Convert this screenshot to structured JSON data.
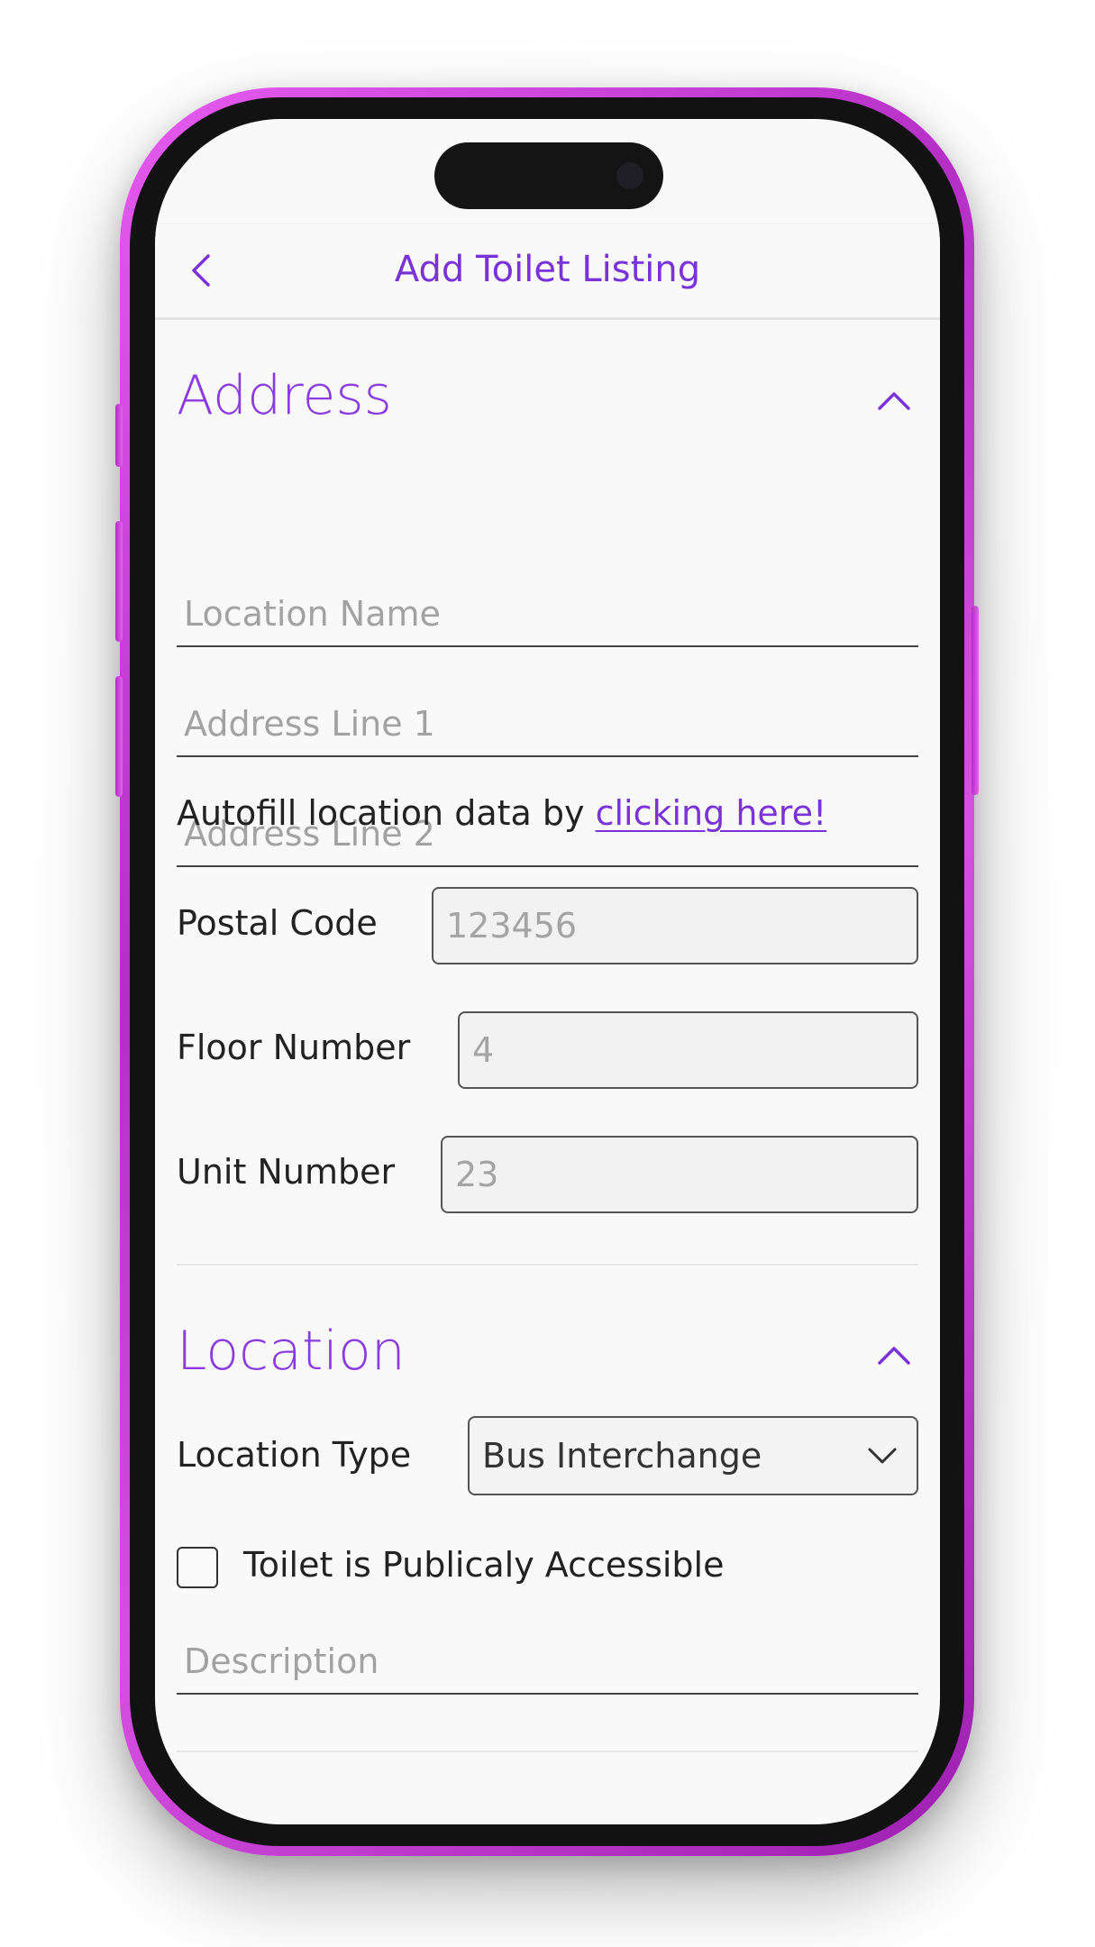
{
  "nav": {
    "title": "Add Toilet Listing"
  },
  "address_section": {
    "title": "Address",
    "location_name_placeholder": "Location Name",
    "address_line1_placeholder": "Address Line 1",
    "address_line2_placeholder": "Address Line 2",
    "autofill_text": "Autofill location data by",
    "autofill_link": "clicking here!",
    "postal_code_label": "Postal Code",
    "postal_code_placeholder": "123456",
    "floor_number_label": "Floor Number",
    "floor_number_placeholder": "4",
    "unit_number_label": "Unit Number",
    "unit_number_placeholder": "23"
  },
  "location_section": {
    "title": "Location",
    "location_type_label": "Location Type",
    "location_type_value": "Bus Interchange",
    "public_access_label": "Toilet is Publicaly Accessible",
    "description_placeholder": "Description"
  },
  "theme": {
    "accent": "#7a33d6",
    "section_title": "#8b3ce0",
    "frame": "#c93dd8"
  },
  "icons": {
    "back": "chevron-left-icon",
    "collapse": "chevron-up-icon",
    "dropdown": "chevron-down-icon"
  }
}
